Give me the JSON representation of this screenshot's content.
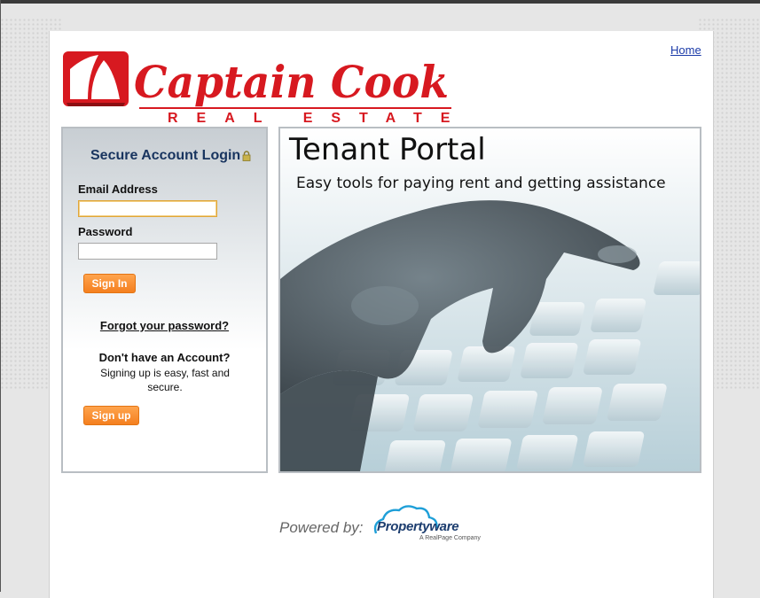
{
  "header": {
    "home_link": "Home",
    "logo_main": "Captain Cook",
    "logo_sub": "REAL ESTATE"
  },
  "login": {
    "title": "Secure Account Login",
    "email_label": "Email Address",
    "email_value": "",
    "password_label": "Password",
    "password_value": "",
    "sign_in_label": "Sign In",
    "forgot_link": "Forgot your password?",
    "no_account_title": "Don't have an Account?",
    "no_account_text": "Signing up is easy, fast and secure.",
    "sign_up_label": "Sign up"
  },
  "hero": {
    "title": "Tenant Portal",
    "subtitle": "Easy tools for paying rent and getting assistance"
  },
  "footer": {
    "powered_by": "Powered by:",
    "vendor_name": "Propertyware",
    "vendor_tagline": "A RealPage Company"
  },
  "colors": {
    "brand_red": "#d71920",
    "button_orange": "#f58a2e",
    "login_title": "#18345f",
    "vendor_blue": "#1b3c6e"
  },
  "icons": [
    "lock-icon",
    "sail-logo-icon",
    "cloud-logo-icon"
  ]
}
